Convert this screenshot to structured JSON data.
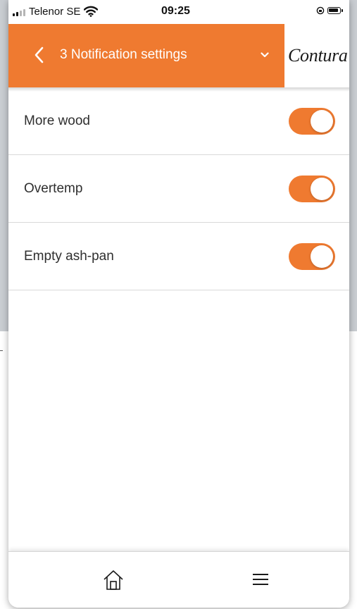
{
  "status_bar": {
    "carrier": "Telenor SE",
    "time": "09:25"
  },
  "header": {
    "title": "3 Notification settings",
    "logo": "Contura",
    "accent_color": "#ef7a30",
    "back_icon": "chevron-left-icon",
    "dropdown_icon": "chevron-down-icon"
  },
  "settings": [
    {
      "label": "More wood",
      "enabled": true
    },
    {
      "label": "Overtemp",
      "enabled": true
    },
    {
      "label": "Empty ash-pan",
      "enabled": true
    }
  ],
  "tab_bar": {
    "items": [
      {
        "icon": "home-icon"
      },
      {
        "icon": "menu-icon"
      }
    ]
  }
}
